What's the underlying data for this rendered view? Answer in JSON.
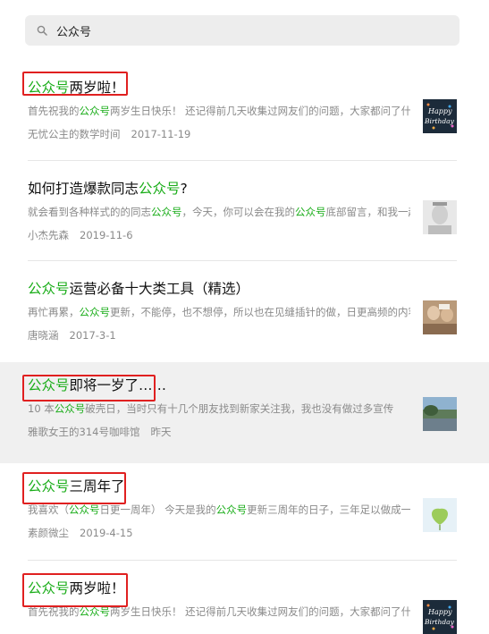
{
  "search": {
    "query": "公众号"
  },
  "results": [
    {
      "title_hl": "公众号",
      "title_rest": "两岁啦！",
      "snippet": [
        {
          "t": "首先祝我的"
        },
        {
          "t": "公众号",
          "hl": true
        },
        {
          "t": "两岁生日快乐！  还记得前几天收集过网友们的问题，大家都问了什么"
        }
      ],
      "author": "无忧公主的数学时间",
      "date": "2017-11-19",
      "thumb": "happy-birthday"
    },
    {
      "title_pre": "如何打造爆款同志",
      "title_hl": "公众号",
      "title_rest": "?",
      "snippet": [
        {
          "t": "就会看到各种样式的的同志"
        },
        {
          "t": "公众号",
          "hl": true
        },
        {
          "t": "，今天，你可以会在我的"
        },
        {
          "t": "公众号",
          "hl": true
        },
        {
          "t": "底部留言，和我一起"
        }
      ],
      "author": "小杰先森",
      "date": "2019-11-6",
      "thumb": "portrait"
    },
    {
      "title_hl": "公众号",
      "title_rest": "运营必备十大类工具（精选）",
      "snippet": [
        {
          "t": "再忙再累，"
        },
        {
          "t": "公众号",
          "hl": true
        },
        {
          "t": "更新，不能停，也不想停，所以也在见缝插针的做，日更高频的内容"
        }
      ],
      "author": "唐晓涵",
      "date": "2017-3-1",
      "thumb": "people"
    },
    {
      "title_hl": "公众号",
      "title_rest": "即将一岁了……",
      "snippet": [
        {
          "t": "10 本"
        },
        {
          "t": "公众号",
          "hl": true
        },
        {
          "t": "破壳日，当时只有十几个朋友找到新家关注我，我也没有做过多宣传"
        }
      ],
      "author": "雅歌女王的314号咖啡馆",
      "date": "昨天",
      "thumb": "landscape"
    },
    {
      "title_hl": "公众号",
      "title_rest": "三周年了",
      "snippet": [
        {
          "t": "我喜欢（"
        },
        {
          "t": "公众号",
          "hl": true
        },
        {
          "t": "日更一周年）  今天是我的"
        },
        {
          "t": "公众号",
          "hl": true
        },
        {
          "t": "更新三周年的日子，三年足以做成一件事"
        }
      ],
      "author": "素颜微尘",
      "date": "2019-4-15",
      "thumb": "ginkgo"
    },
    {
      "title_hl": "公众号",
      "title_rest": "两岁啦！",
      "snippet": [
        {
          "t": "首先祝我的"
        },
        {
          "t": "公众号",
          "hl": true
        },
        {
          "t": "两岁生日快乐！  还记得前几天收集过网友们的问题，大家都问了什么"
        }
      ],
      "author": "",
      "date": "",
      "thumb": "happy-birthday"
    }
  ],
  "thumb_text": {
    "birthday1": "Happy",
    "birthday2": "Birthday"
  },
  "colors": {
    "highlight": "#1aad19",
    "annotation": "#e02020",
    "hover_row": "#f0f0f0"
  }
}
